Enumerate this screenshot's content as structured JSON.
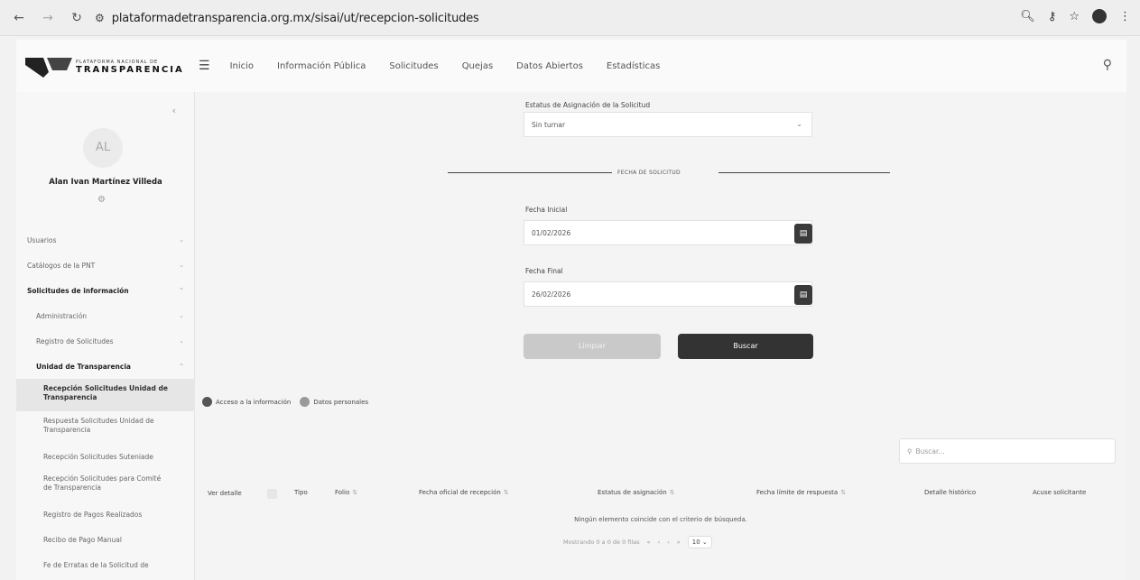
{
  "browser": {
    "url": "plataformadetransparencia.org.mx/sisai/ut/recepcion-solicitudes"
  },
  "header": {
    "logo_top": "PLATAFORMA NACIONAL DE",
    "logo_main": "TRANSPARENCIA",
    "nav": [
      "Inicio",
      "Información Pública",
      "Solicitudes",
      "Quejas",
      "Datos Abiertos",
      "Estadísticas"
    ]
  },
  "sidebar": {
    "avatar_initials": "AL",
    "user_name": "Alan Ivan Martínez Villeda",
    "items": [
      {
        "label": "Usuarios"
      },
      {
        "label": "Catálogos de la PNT"
      },
      {
        "label": "Solicitudes de información"
      },
      {
        "label": "Administración"
      },
      {
        "label": "Registro de Solicitudes"
      },
      {
        "label": "Unidad de Transparencia"
      },
      {
        "label": "Recepción Solicitudes Unidad de Transparencia"
      },
      {
        "label": "Respuesta Solicitudes Unidad de Transparencia"
      },
      {
        "label": "Recepción Solicitudes Suteniade"
      },
      {
        "label": "Recepción Solicitudes para Comité de Transparencia"
      },
      {
        "label": "Registro de Pagos Realizados"
      },
      {
        "label": "Recibo de Pago Manual"
      },
      {
        "label": "Fe de Erratas de la Solicitud de"
      }
    ]
  },
  "filters": {
    "status_label": "Estatus de Asignación de la Solicitud",
    "status_value": "Sin turnar",
    "section_title": "FECHA DE SOLICITUD",
    "start_label": "Fecha Inicial",
    "start_value": "01/02/2026",
    "end_label": "Fecha Final",
    "end_value": "26/02/2026",
    "clear_label": "Limpiar",
    "search_label": "Buscar"
  },
  "legend": {
    "access": "Acceso a la información",
    "personal": "Datos personales",
    "access_color": "#555555",
    "personal_color": "#9a9a9a"
  },
  "table": {
    "search_placeholder": "Buscar...",
    "headers": {
      "detail": "Ver detalle",
      "type": "Tipo",
      "folio": "Folio",
      "official_date": "Fecha oficial de recepción",
      "assign_status": "Estatus de asignación",
      "due_date": "Fecha límite de respuesta",
      "history": "Detalle histórico",
      "receipt": "Acuse solicitante"
    },
    "empty_message": "Ningún elemento coincide con el criterio de búsqueda.",
    "pagination_info": "Mostrando 0 a 0 de 0 filas",
    "page_size": "10"
  }
}
